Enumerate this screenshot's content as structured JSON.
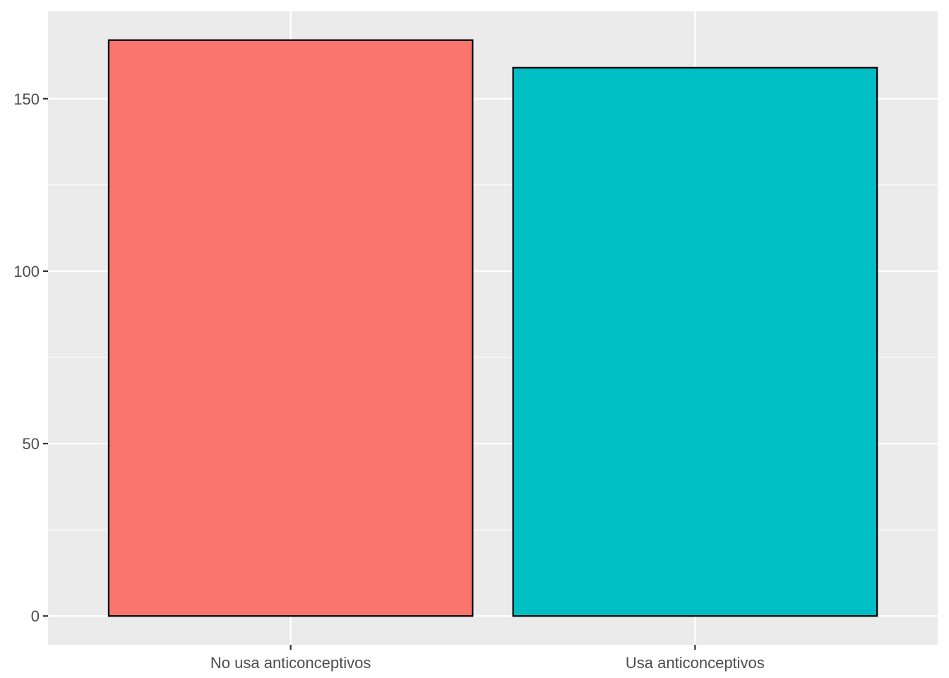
{
  "chart_data": {
    "type": "bar",
    "categories": [
      "No usa anticonceptivos",
      "Usa anticonceptivos"
    ],
    "values": [
      167,
      159
    ],
    "colors": [
      "#F8766D",
      "#00BFC4"
    ],
    "bar_outline": "#000000",
    "panel_background": "#EBEBEB",
    "gridline_color": "#FFFFFF",
    "ylim": [
      -8.35,
      175.35
    ],
    "yticks": [
      0,
      50,
      100,
      150
    ],
    "ytick_labels": [
      "0",
      "50",
      "100",
      "150"
    ],
    "y_minor_ticks": [
      25,
      75,
      125
    ],
    "grid": true,
    "legend": "none",
    "title": "",
    "xlabel": "",
    "ylabel": ""
  }
}
